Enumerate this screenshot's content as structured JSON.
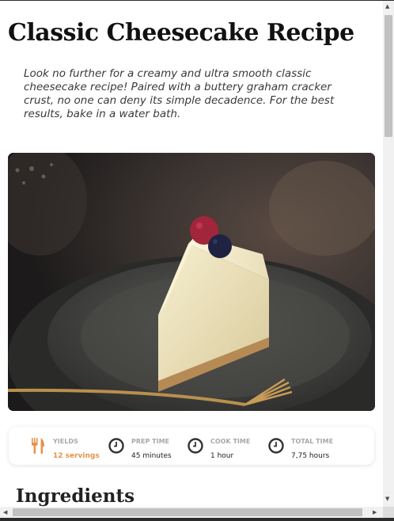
{
  "recipe": {
    "title": "Classic Cheesecake Recipe",
    "intro": "Look no further for a creamy and ultra smooth classic cheesecake recipe! Paired with a buttery graham cracker crust, no one can deny its simple decadence. For the best results, bake in a water bath."
  },
  "stats": [
    {
      "icon": "fork-knife-icon",
      "label": "YIELDS",
      "value": "12 servings"
    },
    {
      "icon": "clock-icon",
      "label": "PREP TIME",
      "value": "45 minutes"
    },
    {
      "icon": "clock-icon",
      "label": "COOK TIME",
      "value": "1 hour"
    },
    {
      "icon": "clock-icon",
      "label": "TOTAL TIME",
      "value": "7,75 hours"
    }
  ],
  "sections": {
    "ingredients_title": "Ingredients"
  },
  "colors": {
    "accent": "#e8914a",
    "label_gray": "#a8a8a8",
    "icon_dark": "#333333"
  },
  "scrollbars": {
    "up_arrow": "▲",
    "down_arrow": "▼",
    "left_arrow": "◀",
    "right_arrow": "▶"
  }
}
